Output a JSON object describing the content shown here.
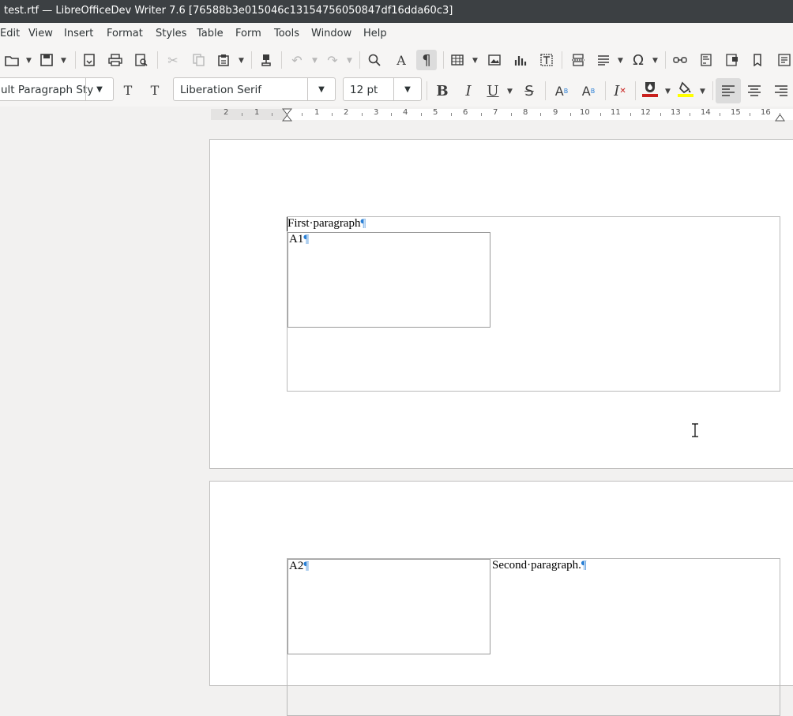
{
  "window": {
    "title": "test.rtf — LibreOfficeDev Writer 7.6 [76588b3e015046c13154756050847df16dda60c3]"
  },
  "menu": [
    "Edit",
    "View",
    "Insert",
    "Format",
    "Styles",
    "Table",
    "Form",
    "Tools",
    "Window",
    "Help"
  ],
  "formatting": {
    "paragraph_style": "ult Paragraph Sty",
    "font_name": "Liberation Serif",
    "font_size": "12 pt"
  },
  "ruler": {
    "labels": [
      "2",
      "1",
      "1",
      "2",
      "3",
      "4",
      "5",
      "6",
      "7",
      "8",
      "9",
      "10",
      "11",
      "12",
      "13",
      "14",
      "15",
      "16"
    ]
  },
  "document": {
    "page1": {
      "paragraph": "First·paragraph",
      "frame_text": "A1"
    },
    "page2": {
      "frame_text": "A2",
      "paragraph": "Second·paragraph."
    },
    "pilcrow": "¶"
  },
  "colors": {
    "accent_pilcrow": "#2a7fd4",
    "font_color": "#c9211e",
    "highlight": "#ffff00",
    "titlebar": "#3c4043"
  }
}
